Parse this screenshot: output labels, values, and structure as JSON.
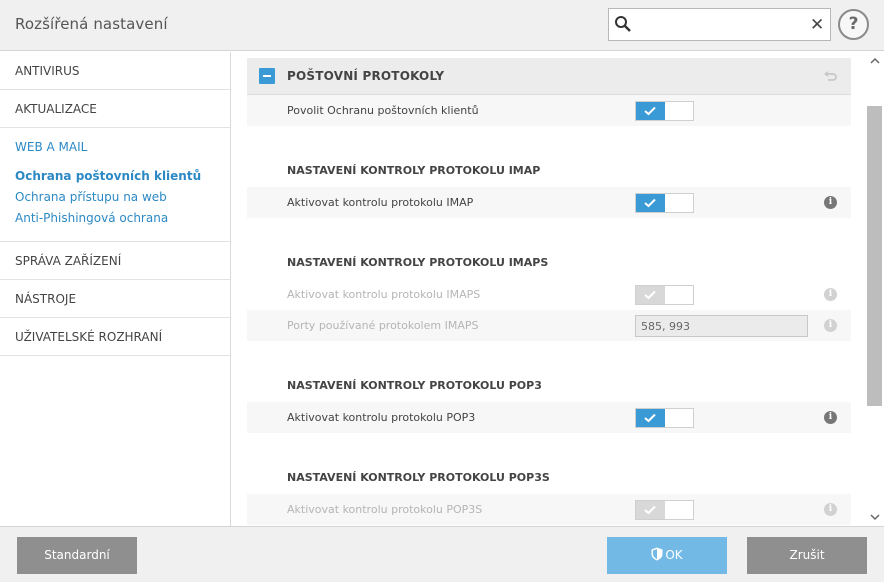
{
  "header": {
    "title": "Rozšířená nastavení",
    "search_value": "",
    "help_label": "?"
  },
  "sidebar": {
    "items_top": [
      {
        "label": "ANTIVIRUS"
      },
      {
        "label": "AKTUALIZACE"
      }
    ],
    "group": {
      "title": "WEB A MAIL",
      "subitems": [
        {
          "label": "Ochrana poštovních klientů",
          "active": true
        },
        {
          "label": "Ochrana přístupu na web"
        },
        {
          "label": "Anti-Phishingová ochrana"
        }
      ]
    },
    "items_bottom": [
      {
        "label": "SPRÁVA ZAŘÍZENÍ"
      },
      {
        "label": "NÁSTROJE"
      },
      {
        "label": "UŽIVATELSKÉ ROZHRANÍ"
      }
    ]
  },
  "content": {
    "section_title": "POŠTOVNÍ PROTOKOLY",
    "enable_row": {
      "label": "Povolit Ochranu poštovních klientů",
      "checked": true
    },
    "imap": {
      "heading": "NASTAVENÍ KONTROLY PROTOKOLU IMAP",
      "activate_label": "Aktivovat kontrolu protokolu IMAP"
    },
    "imaps": {
      "heading": "NASTAVENÍ KONTROLY PROTOKOLU IMAPS",
      "activate_label": "Aktivovat kontrolu protokolu IMAPS",
      "ports_label": "Porty používané protokolem IMAPS",
      "ports_value": "585, 993"
    },
    "pop3": {
      "heading": "NASTAVENÍ KONTROLY PROTOKOLU POP3",
      "activate_label": "Aktivovat kontrolu protokolu POP3"
    },
    "pop3s": {
      "heading": "NASTAVENÍ KONTROLY PROTOKOLU POP3S",
      "activate_label": "Aktivovat kontrolu protokolu POP3S"
    }
  },
  "footer": {
    "standard_label": "Standardní",
    "ok_label": "OK",
    "cancel_label": "Zrušit"
  },
  "colors": {
    "accent": "#3a9ad6",
    "link": "#2c89c5",
    "ok_button": "#73b9e5",
    "gray_button": "#8f8f8f"
  }
}
